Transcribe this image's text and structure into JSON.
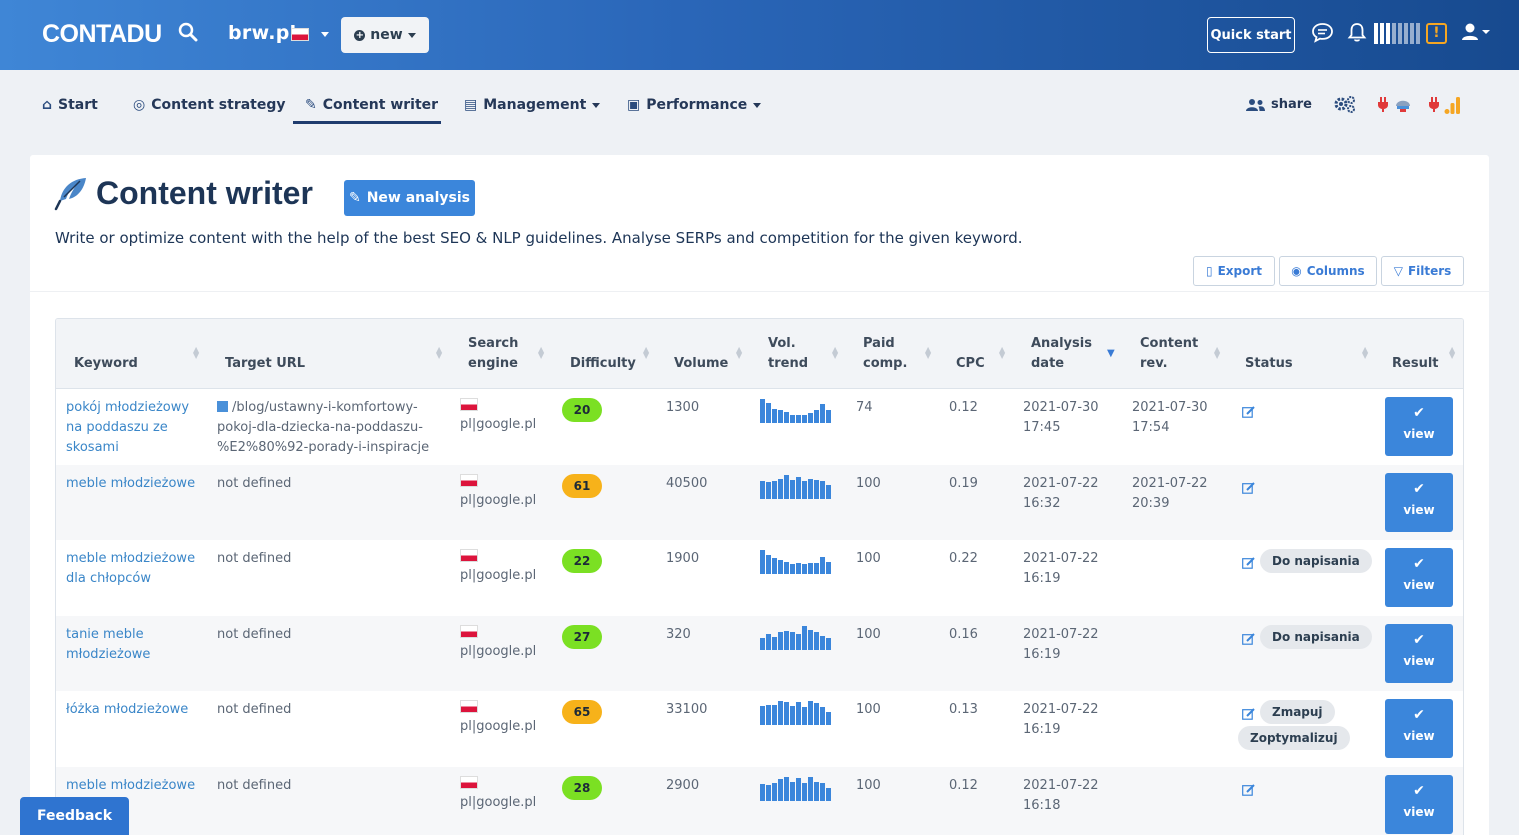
{
  "header": {
    "logo": "CONTADU",
    "domain": "brw.pl",
    "new_label": "new",
    "quick_start": "Quick start"
  },
  "nav": {
    "items": [
      {
        "label": "Start",
        "icon": "home-icon"
      },
      {
        "label": "Content strategy",
        "icon": "strategy-icon"
      },
      {
        "label": "Content writer",
        "icon": "feather-icon",
        "active": true
      },
      {
        "label": "Management",
        "icon": "clipboard-icon"
      },
      {
        "label": "Performance",
        "icon": "chart-monitor-icon"
      }
    ],
    "share": "share"
  },
  "page": {
    "title": "Content writer",
    "new_analysis": "New analysis",
    "subtitle": "Write or optimize content with the help of the best SEO & NLP guidelines. Analyse SERPs and competition for the given keyword.",
    "export": "Export",
    "columns": "Columns",
    "filters": "Filters"
  },
  "table": {
    "headers": {
      "keyword": "Keyword",
      "target_url": "Target URL",
      "search_engine_1": "Search",
      "search_engine_2": "engine",
      "difficulty": "Difficulty",
      "volume": "Volume",
      "vol_trend_1": "Vol.",
      "vol_trend_2": "trend",
      "paid_comp_1": "Paid",
      "paid_comp_2": "comp.",
      "cpc": "CPC",
      "analysis_date_1": "Analysis",
      "analysis_date_2": "date",
      "content_rev_1": "Content",
      "content_rev_2": "rev.",
      "status": "Status",
      "result": "Result"
    },
    "rows": [
      {
        "kw1": "pokój młodzieżowy",
        "kw2": "na poddaszu ze",
        "kw3": "skosami",
        "url1": "/blog/ustawny-i-komfortowy-",
        "url2": "pokoj-dla-dziecka-na-poddaszu-",
        "url3": "%E2%80%92-porady-i-inspiracje",
        "engine": "pl|google.pl",
        "difficulty": "20",
        "volume": "1300",
        "paid": "74",
        "cpc": "0.12",
        "adate1": "2021-07-30",
        "adate2": "17:45",
        "crev1": "2021-07-30",
        "crev2": "17:54",
        "view": "view"
      },
      {
        "kw1": "meble młodzieżowe",
        "kw2": "",
        "kw3": "",
        "url1": "not defined",
        "url2": "",
        "url3": "",
        "engine": "pl|google.pl",
        "difficulty": "61",
        "volume": "40500",
        "paid": "100",
        "cpc": "0.19",
        "adate1": "2021-07-22",
        "adate2": "16:32",
        "crev1": "2021-07-22",
        "crev2": "20:39",
        "view": "view"
      },
      {
        "kw1": "meble młodzieżowe",
        "kw2": "dla chłopców",
        "kw3": "",
        "url1": "not defined",
        "url2": "",
        "url3": "",
        "engine": "pl|google.pl",
        "difficulty": "22",
        "volume": "1900",
        "paid": "100",
        "cpc": "0.22",
        "adate1": "2021-07-22",
        "adate2": "16:19",
        "crev1": "",
        "crev2": "",
        "status1": "Do napisania",
        "view": "view"
      },
      {
        "kw1": "tanie meble",
        "kw2": "młodzieżowe",
        "kw3": "",
        "url1": "not defined",
        "url2": "",
        "url3": "",
        "engine": "pl|google.pl",
        "difficulty": "27",
        "volume": "320",
        "paid": "100",
        "cpc": "0.16",
        "adate1": "2021-07-22",
        "adate2": "16:19",
        "crev1": "",
        "crev2": "",
        "status1": "Do napisania",
        "view": "view"
      },
      {
        "kw1": "łóżka młodzieżowe",
        "kw2": "",
        "kw3": "",
        "url1": "not defined",
        "url2": "",
        "url3": "",
        "engine": "pl|google.pl",
        "difficulty": "65",
        "volume": "33100",
        "paid": "100",
        "cpc": "0.13",
        "adate1": "2021-07-22",
        "adate2": "16:19",
        "crev1": "",
        "crev2": "",
        "status1": "Zmapuj",
        "status2": "Zoptymalizuj",
        "view": "view"
      },
      {
        "kw1": "meble młodzieżowe",
        "kw2": "",
        "kw3": "",
        "url1": "not defined",
        "url2": "",
        "url3": "",
        "engine": "pl|google.pl",
        "difficulty": "28",
        "volume": "2900",
        "paid": "100",
        "cpc": "0.12",
        "adate1": "2021-07-22",
        "adate2": "16:18",
        "crev1": "",
        "crev2": "",
        "view": "view"
      }
    ],
    "difficulty_colors": [
      "#7be023",
      "#f7b21a",
      "#7be023",
      "#7be023",
      "#f7b21a",
      "#7be023"
    ],
    "trends": [
      [
        1,
        0.85,
        0.6,
        0.55,
        0.45,
        0.35,
        0.35,
        0.35,
        0.4,
        0.55,
        0.8,
        0.55
      ],
      [
        0.75,
        0.7,
        0.75,
        0.85,
        1,
        0.8,
        0.9,
        0.75,
        0.85,
        0.8,
        0.75,
        0.6
      ],
      [
        1,
        0.8,
        0.65,
        0.6,
        0.5,
        0.4,
        0.45,
        0.4,
        0.45,
        0.45,
        0.7,
        0.5
      ],
      [
        0.5,
        0.65,
        0.55,
        0.75,
        0.8,
        0.75,
        0.65,
        1,
        0.85,
        0.75,
        0.6,
        0.5
      ],
      [
        0.8,
        0.85,
        0.85,
        1,
        0.95,
        0.8,
        0.95,
        0.75,
        1,
        0.9,
        0.75,
        0.55
      ],
      [
        0.7,
        0.65,
        0.75,
        0.9,
        1,
        0.8,
        0.95,
        0.75,
        1,
        0.8,
        0.75,
        0.55
      ]
    ]
  },
  "feedback": "Feedback"
}
